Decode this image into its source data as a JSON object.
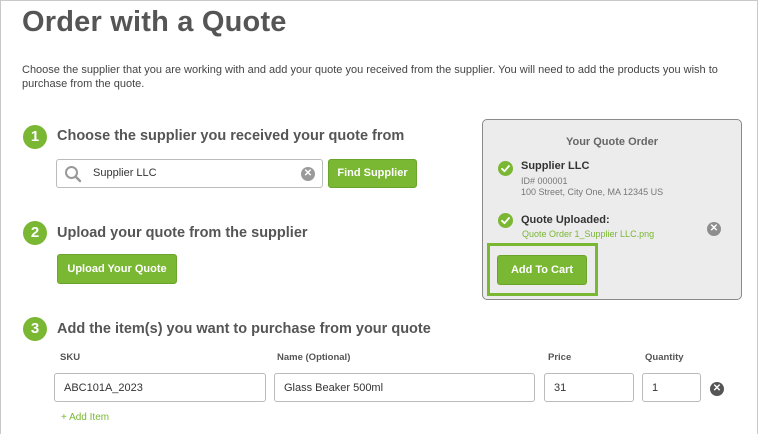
{
  "page": {
    "title": "Order with a Quote",
    "intro": "Choose the supplier that you are working with and add your quote you received from the supplier. You will need to add the products you wish to purchase from the quote."
  },
  "steps": [
    {
      "number": "1",
      "title": "Choose the supplier you received your quote from"
    },
    {
      "number": "2",
      "title": "Upload your quote from the supplier"
    },
    {
      "number": "3",
      "title": "Add the item(s) you want to purchase from your quote"
    }
  ],
  "supplier_search": {
    "value": "Supplier LLC",
    "button_label": "Find Supplier"
  },
  "upload": {
    "button_label": "Upload Your Quote"
  },
  "quote_panel": {
    "title": "Your Quote Order",
    "supplier_name": "Supplier LLC",
    "supplier_id": "ID# 000001",
    "supplier_address": "100 Street, City One, MA 12345 US",
    "quote_label": "Quote Uploaded:",
    "quote_file": "Quote Order 1_Supplier LLC.png",
    "add_to_cart_label": "Add To Cart"
  },
  "items_table": {
    "headers": {
      "sku": "SKU",
      "name": "Name (Optional)",
      "price": "Price",
      "quantity": "Quantity"
    },
    "rows": [
      {
        "sku": "ABC101A_2023",
        "name": "Glass Beaker 500ml",
        "price": "31",
        "quantity": "1"
      }
    ],
    "add_item_label": "+ Add Item"
  },
  "colors": {
    "accent_green": "#7ab733",
    "panel_background": "#ececec",
    "title_gray": "#555555"
  },
  "icons": [
    "search-icon",
    "clear-icon",
    "check-icon",
    "remove-icon"
  ]
}
